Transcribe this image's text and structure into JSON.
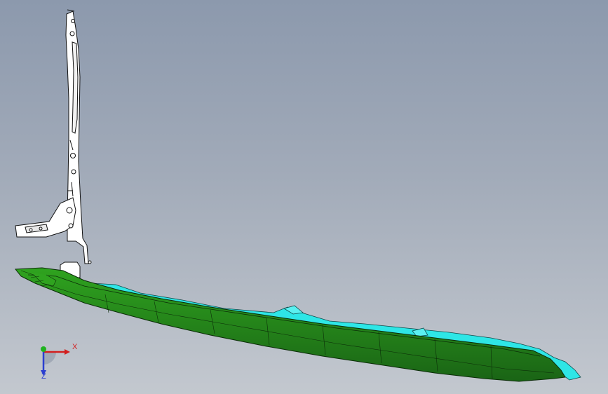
{
  "viewport": {
    "background_top": "#8c99ad",
    "background_bottom": "#c3c8cf"
  },
  "model": {
    "bracket_color": "#ffffff",
    "bumper_color": "#1f7a1a",
    "bumper_highlight_color": "#2fa31f",
    "insert_color": "#2ee6e6",
    "edge_color": "#111111"
  },
  "triad": {
    "x_label": "X",
    "z_label": "Z",
    "x_color": "#d21f1f",
    "y_color": "#1fb31f",
    "z_color": "#2b3fd0"
  }
}
